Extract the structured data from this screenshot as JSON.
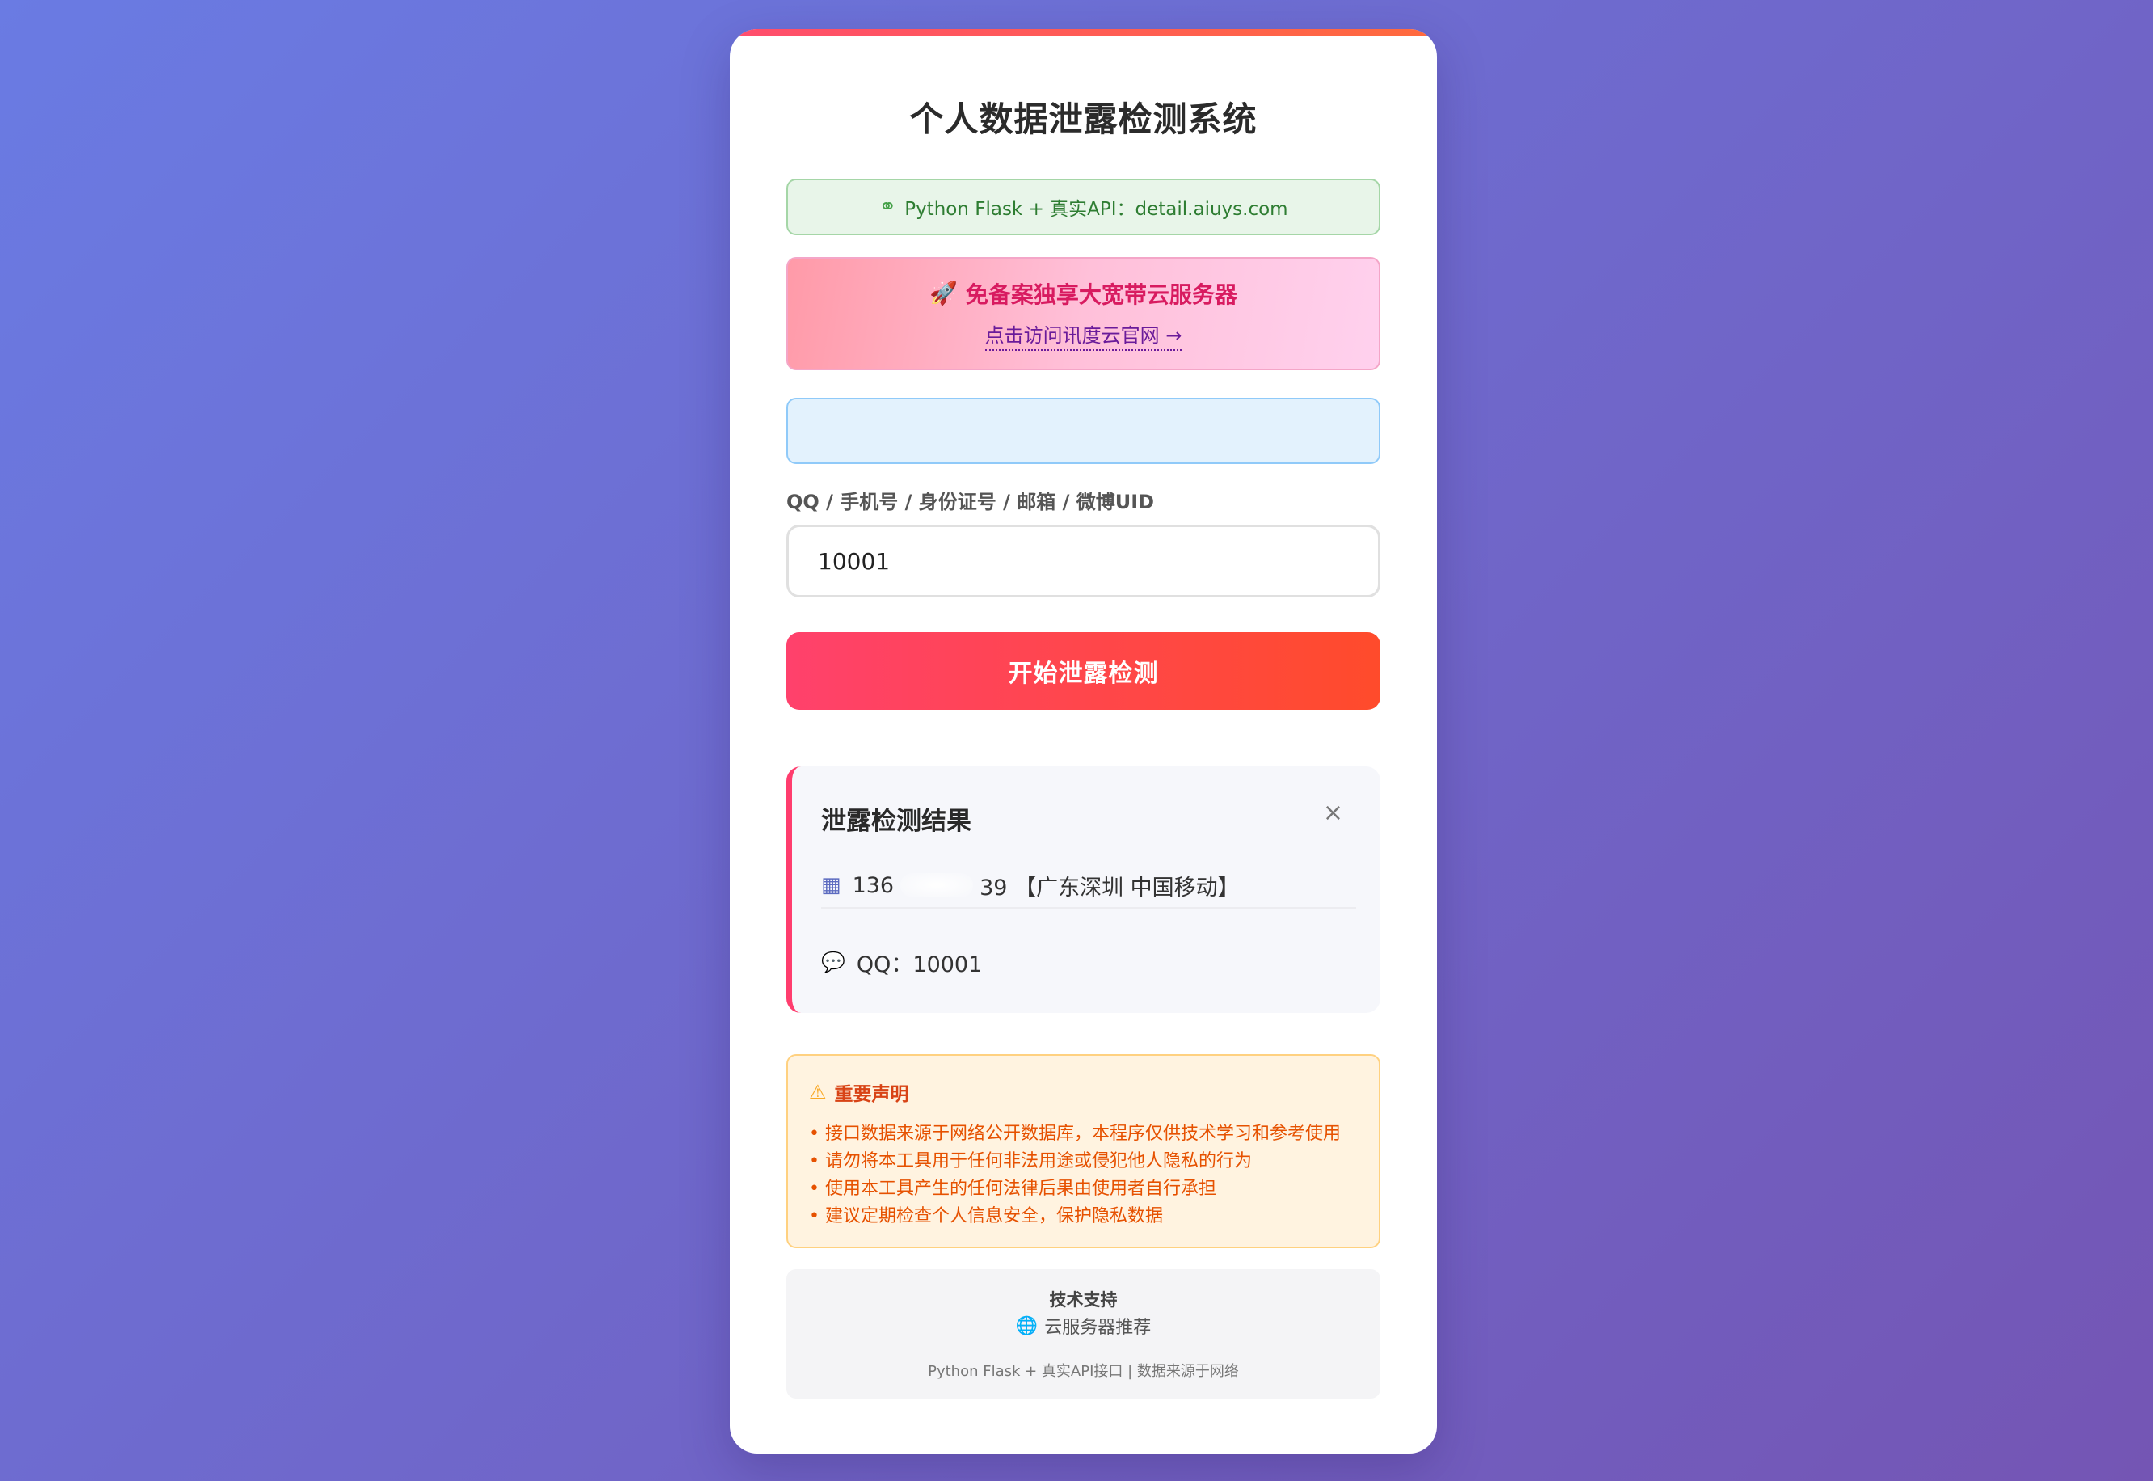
{
  "header": {
    "title": "个人数据泄露检测系统"
  },
  "api_banner": {
    "icon": "link-icon",
    "text": "Python Flask + 真实API：detail.aiuys.com"
  },
  "ad_banner": {
    "icon": "rocket-icon",
    "title": "免备案独享大宽带云服务器",
    "link": "点击访问讯度云官网 →"
  },
  "form": {
    "label": "QQ / 手机号 / 身份证号 / 邮箱 / 微博UID",
    "value": "10001",
    "submit_label": "开始泄露检测"
  },
  "result": {
    "title": "泄露检测结果",
    "close": "×",
    "rows": [
      {
        "icon": "phone-icon",
        "prefix": "136",
        "suffix": "39 【广东深圳 中国移动】"
      },
      {
        "icon": "chat-icon",
        "text": "QQ：10001"
      }
    ]
  },
  "notice": {
    "icon": "warning-icon",
    "title": "重要声明",
    "items": [
      "• 接口数据来源于网络公开数据库，本程序仅供技术学习和参考使用",
      "• 请勿将本工具用于任何非法用途或侵犯他人隐私的行为",
      "• 使用本工具产生的任何法律后果由使用者自行承担",
      "• 建议定期检查个人信息安全，保护隐私数据"
    ]
  },
  "footer": {
    "title": "技术支持",
    "link": "云服务器推荐",
    "note": "Python Flask + 真实API接口 | 数据来源于网络"
  }
}
